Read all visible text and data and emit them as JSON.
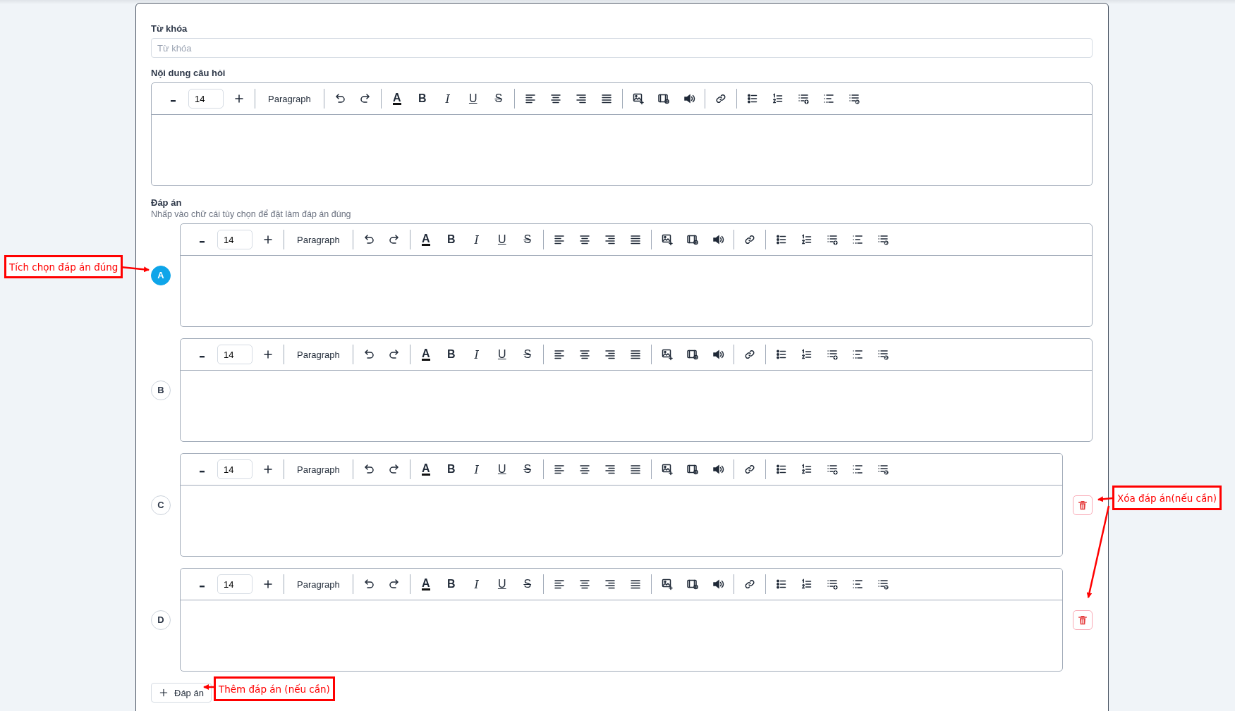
{
  "keyword": {
    "label": "Từ khóa",
    "placeholder": "Từ khóa"
  },
  "question": {
    "label": "Nội dung câu hỏi",
    "toolbar": {
      "size": "14",
      "block": "Paragraph",
      "format": [
        {
          "kind": "color",
          "label": "A"
        },
        {
          "kind": "bold",
          "label": "B"
        },
        {
          "kind": "italic",
          "label": "I"
        },
        {
          "kind": "underline",
          "label": "U"
        },
        {
          "kind": "strike",
          "label": "S"
        }
      ]
    }
  },
  "answers": {
    "label": "Đáp án",
    "hint": "Nhấp vào chữ cái tùy chọn để đặt làm đáp án đúng",
    "options": [
      {
        "letter": "A",
        "selected": true,
        "removable": false,
        "toolbar": {
          "size": "14",
          "block": "Paragraph",
          "format": [
            {
              "kind": "color",
              "label": "A"
            },
            {
              "kind": "bold",
              "label": "B"
            },
            {
              "kind": "italic",
              "label": "I"
            },
            {
              "kind": "underline",
              "label": "U"
            },
            {
              "kind": "strike",
              "label": "S"
            }
          ]
        }
      },
      {
        "letter": "B",
        "selected": false,
        "removable": false,
        "toolbar": {
          "size": "14",
          "block": "Paragraph",
          "format": [
            {
              "kind": "color",
              "label": "A"
            },
            {
              "kind": "bold",
              "label": "B"
            },
            {
              "kind": "italic",
              "label": "I"
            },
            {
              "kind": "underline",
              "label": "U"
            },
            {
              "kind": "strike",
              "label": "S"
            }
          ]
        }
      },
      {
        "letter": "C",
        "selected": false,
        "removable": true,
        "toolbar": {
          "size": "14",
          "block": "Paragraph",
          "format": [
            {
              "kind": "color",
              "label": "A"
            },
            {
              "kind": "bold",
              "label": "B"
            },
            {
              "kind": "italic",
              "label": "I"
            },
            {
              "kind": "underline",
              "label": "U"
            },
            {
              "kind": "strike",
              "label": "S"
            }
          ]
        }
      },
      {
        "letter": "D",
        "selected": false,
        "removable": true,
        "toolbar": {
          "size": "14",
          "block": "Paragraph",
          "format": [
            {
              "kind": "color",
              "label": "A"
            },
            {
              "kind": "bold",
              "label": "B"
            },
            {
              "kind": "italic",
              "label": "I"
            },
            {
              "kind": "underline",
              "label": "U"
            },
            {
              "kind": "strike",
              "label": "S"
            }
          ]
        }
      }
    ],
    "add_button": "Đáp án"
  },
  "callouts": [
    {
      "text": "Tích chọn đáp án đúng"
    },
    {
      "text": "Xóa đáp án(nếu cần)"
    },
    {
      "text": "Thêm đáp án (nếu cần)"
    }
  ]
}
